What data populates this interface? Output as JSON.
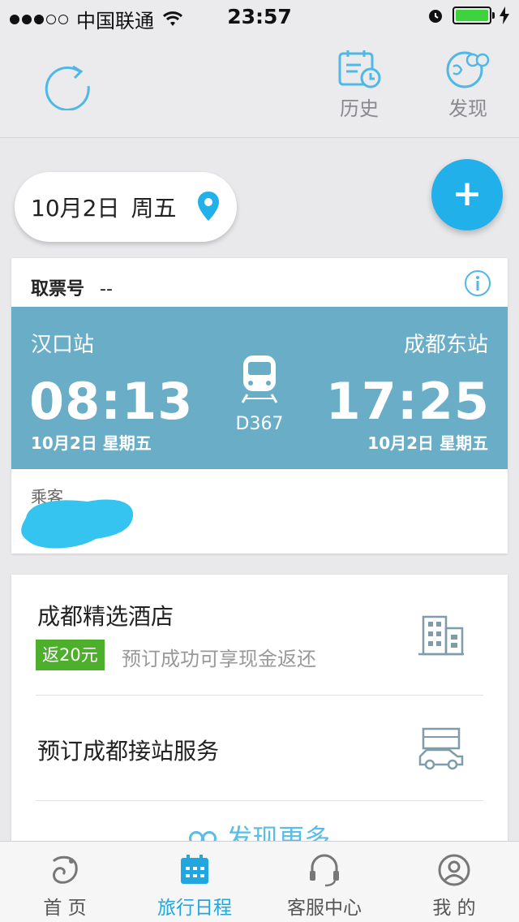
{
  "status_bar": {
    "carrier": "中国联通",
    "time": "23:57"
  },
  "toolbar": {
    "history_label": "历史",
    "discover_label": "发现"
  },
  "date_selector": {
    "date": "10月2日",
    "weekday": "周五"
  },
  "ticket": {
    "pickup_label": "取票号",
    "pickup_value": "--",
    "from_station": "汉口站",
    "to_station": "成都东站",
    "departure_time": "08:13",
    "arrival_time": "17:25",
    "departure_date": "10月2日 星期五",
    "arrival_date": "10月2日 星期五",
    "train_number": "D367",
    "passenger_label": "乘客"
  },
  "services": {
    "hotel_title": "成都精选酒店",
    "hotel_badge": "返20元",
    "hotel_desc": "预订成功可享现金返还",
    "pickup_title": "预订成都接站服务",
    "more_label": "发现更多"
  },
  "tabbar": {
    "tabs": [
      {
        "label": "首 页"
      },
      {
        "label": "旅行日程"
      },
      {
        "label": "客服中心"
      },
      {
        "label": "我 的"
      }
    ],
    "active_index": 1
  },
  "colors": {
    "accent": "#22b0ea",
    "ticket_band": "#6aadc7",
    "badge_green": "#4daf2c"
  },
  "icons": [
    "refresh-icon",
    "history-icon",
    "discover-icon",
    "location-pin-icon",
    "plus-icon",
    "info-icon",
    "train-icon",
    "hotel-icon",
    "car-icon",
    "home-icon",
    "calendar-icon",
    "headset-icon",
    "profile-icon"
  ]
}
